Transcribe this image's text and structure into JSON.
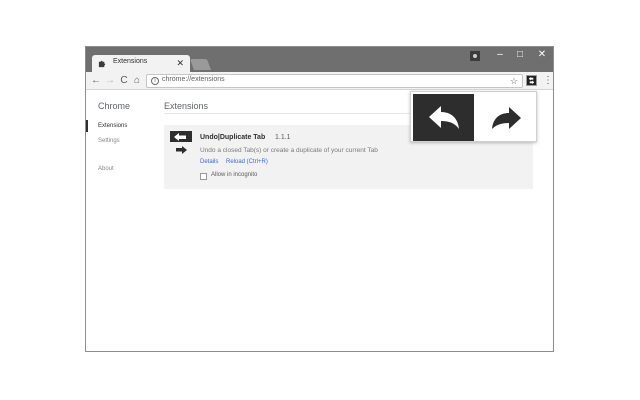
{
  "window": {
    "controls": {
      "minimize": "–",
      "maximize": "□",
      "close": "✕"
    }
  },
  "tab": {
    "title": "Extensions",
    "close": "✕",
    "favicon": "puzzle-icon"
  },
  "toolbar": {
    "back": "←",
    "forward": "→",
    "reload": "C",
    "home": "⌂",
    "url": "chrome://extensions",
    "bookmark": "☆",
    "menu": "⋮"
  },
  "sidebar": {
    "title": "Chrome",
    "items": [
      {
        "label": "Extensions",
        "active": true
      },
      {
        "label": "Settings",
        "active": false
      },
      {
        "label": "About",
        "active": false
      }
    ]
  },
  "main": {
    "title": "Extensions"
  },
  "extension": {
    "name": "Undo|Duplicate Tab",
    "version": "1.1.1",
    "description": "Undo a closed Tab(s) or create a duplicate of your current Tab",
    "details_link": "Details",
    "reload_link": "Reload (Ctrl+R)",
    "incognito_label": "Allow in incognito",
    "incognito_checked": false,
    "icon": "undo-duplicate-icon"
  },
  "popup": {
    "undo_icon": "undo-arrow-icon",
    "duplicate_icon": "redo-arrow-icon"
  },
  "colors": {
    "titlebar": "#6f6f70",
    "link": "#3b6ad6",
    "popup_dark": "#2d2d2d"
  }
}
